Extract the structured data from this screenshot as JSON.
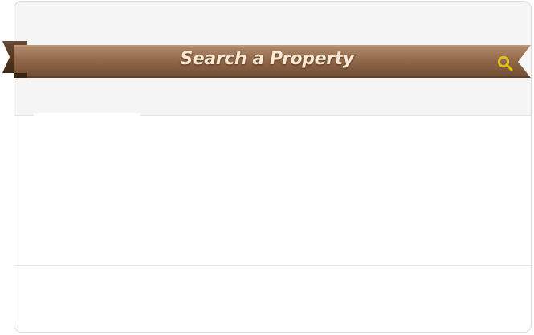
{
  "banner": {
    "title": "Search a Property",
    "icon": "search-icon",
    "color_main": "#8f6446",
    "color_light": "#a88063",
    "color_dark": "#5e3e28",
    "icon_color": "#e5c100"
  }
}
